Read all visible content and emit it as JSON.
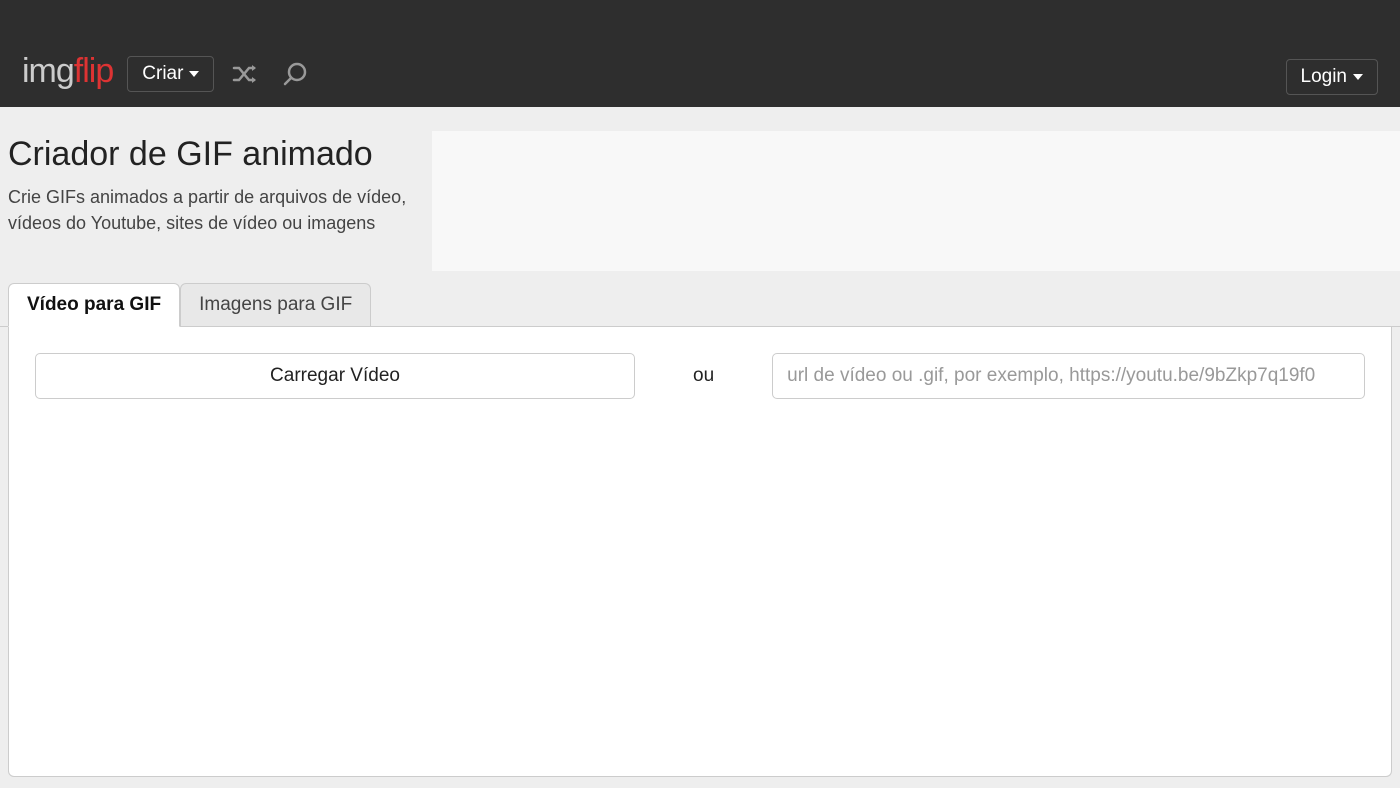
{
  "header": {
    "logo_part1": "img",
    "logo_part2": "flip",
    "create_label": "Criar",
    "login_label": "Login"
  },
  "title": {
    "heading": "Criador de GIF animado",
    "subheading": "Crie GIFs animados a partir de arquivos de vídeo, vídeos do Youtube, sites de vídeo ou imagens"
  },
  "tabs": {
    "video": "Vídeo para GIF",
    "images": "Imagens para GIF"
  },
  "panel": {
    "upload_label": "Carregar Vídeo",
    "or_label": "ou",
    "url_placeholder": "url de vídeo ou .gif, por exemplo, https://youtu.be/9bZkp7q19f0"
  }
}
